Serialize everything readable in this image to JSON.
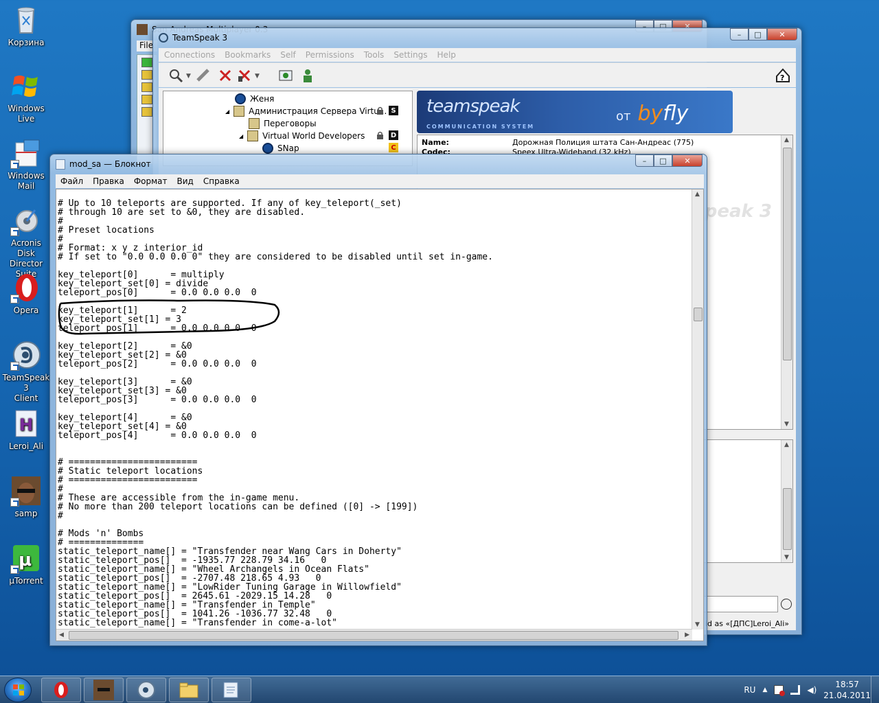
{
  "desktop": {
    "icons": [
      {
        "label": "Корзина"
      },
      {
        "label": "Windows\nLive"
      },
      {
        "label": "Windows\nMail"
      },
      {
        "label": "Acronis Disk\nDirector Suite"
      },
      {
        "label": "Opera"
      },
      {
        "label": "TeamSpeak 3\nClient"
      },
      {
        "label": "Leroi_Ali"
      },
      {
        "label": "samp"
      },
      {
        "label": "µTorrent"
      }
    ]
  },
  "samp_window": {
    "title": "San Andreas Multiplayer 0.3",
    "menu_file": "File"
  },
  "teamspeak": {
    "title": "TeamSpeak 3",
    "menu": [
      "Connections",
      "Bookmarks",
      "Self",
      "Permissions",
      "Tools",
      "Settings",
      "Help"
    ],
    "tree": [
      {
        "label": "Женя"
      },
      {
        "label": "Администрация Сервера Virtu...",
        "badge": "S"
      },
      {
        "label": "Переговоры"
      },
      {
        "label": "Virtual World Developers",
        "badge": "D"
      },
      {
        "label": "SNap",
        "badge": "C"
      }
    ],
    "banner": {
      "logo": "teamspeak",
      "sub": "COMMUNICATION SYSTEM",
      "ot": "от",
      "by": "by",
      "fly": "fly"
    },
    "info": {
      "name_label": "Name:",
      "name_value": "Дорожная Полиция штата Сан-Андреас (775)",
      "codec_label": "Codec:",
      "codec_value": "Speex Ultra-Wideband (32 kHz)"
    },
    "watermark": "teamspeak 3",
    "status_nick": "id as «[ДПС]Leroi_Ali»"
  },
  "notepad": {
    "title": "mod_sa — Блокнот",
    "menu": [
      "Файл",
      "Правка",
      "Формат",
      "Вид",
      "Справка"
    ],
    "lines": [
      "# Up to 10 teleports are supported. If any of key_teleport(_set)",
      "# through 10 are set to &0, they are disabled.",
      "#",
      "# Preset locations",
      "#",
      "# Format: x y z interior_id",
      "# If set to \"0.0 0.0 0.0 0\" they are considered to be disabled until set in-game.",
      "",
      "key_teleport[0]      = multiply",
      "key_teleport_set[0] = divide",
      "teleport_pos[0]      = 0.0 0.0 0.0  0",
      "",
      "key_teleport[1]      = 2",
      "key_teleport_set[1] = 3",
      "teleport_pos[1]      = 0.0 0.0 0.0  0",
      "",
      "key_teleport[2]      = &0",
      "key_teleport_set[2] = &0",
      "teleport_pos[2]      = 0.0 0.0 0.0  0",
      "",
      "key_teleport[3]      = &0",
      "key_teleport_set[3] = &0",
      "teleport_pos[3]      = 0.0 0.0 0.0  0",
      "",
      "key_teleport[4]      = &0",
      "key_teleport_set[4] = &0",
      "teleport_pos[4]      = 0.0 0.0 0.0  0",
      "",
      "",
      "# ========================",
      "# Static teleport locations",
      "# ========================",
      "#",
      "# These are accessible from the in-game menu.",
      "# No more than 200 teleport locations can be defined ([0] -> [199])",
      "#",
      "",
      "# Mods 'n' Bombs",
      "# ==============",
      "static_teleport_name[] = \"Transfender near Wang Cars in Doherty\"",
      "static_teleport_pos[]  = -1935.77 228.79 34.16   0",
      "static_teleport_name[] = \"Wheel Archangels in Ocean Flats\"",
      "static_teleport_pos[]  = -2707.48 218.65 4.93   0",
      "static_teleport_name[] = \"LowRider Tuning Garage in Willowfield\"",
      "static_teleport_pos[]  = 2645.61 -2029.15 14.28   0",
      "static_teleport_name[] = \"Transfender in Temple\"",
      "static_teleport_pos[]  = 1041.26 -1036.77 32.48   0",
      "static_teleport_name[] = \"Transfender in come-a-lot\""
    ]
  },
  "taskbar": {
    "lang": "RU",
    "time": "18:57",
    "date": "21.04.2011"
  },
  "colors": {
    "desktop": "#1565b0",
    "highlight_circle": "#000000",
    "opera_red": "#d81e1e",
    "byfly_orange": "#f28c1e"
  }
}
